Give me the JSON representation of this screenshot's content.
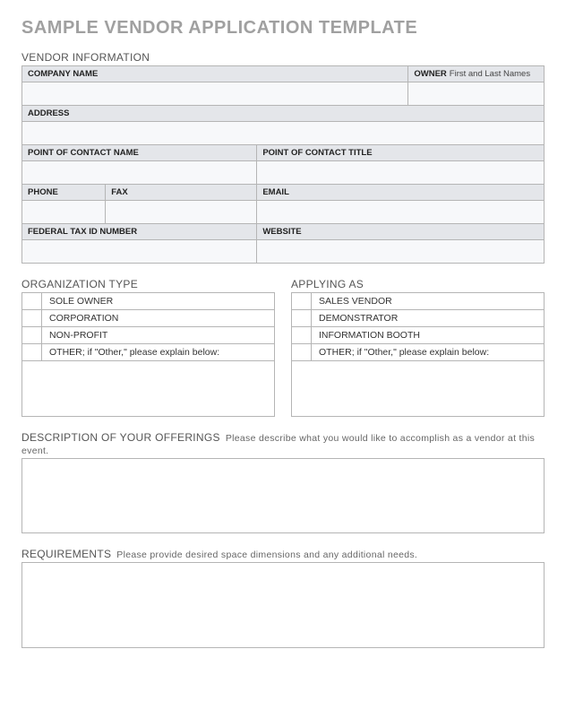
{
  "title": "SAMPLE VENDOR APPLICATION TEMPLATE",
  "vendor_info": {
    "section_label": "VENDOR INFORMATION",
    "company_label": "COMPANY NAME",
    "company_value": "",
    "owner_label": "OWNER",
    "owner_sub": "First and Last Names",
    "owner_value": "",
    "address_label": "ADDRESS",
    "address_value": "",
    "poc_name_label": "POINT OF CONTACT NAME",
    "poc_name_value": "",
    "poc_title_label": "POINT OF CONTACT TITLE",
    "poc_title_value": "",
    "phone_label": "PHONE",
    "phone_value": "",
    "fax_label": "FAX",
    "fax_value": "",
    "email_label": "EMAIL",
    "email_value": "",
    "tax_label": "FEDERAL TAX ID NUMBER",
    "tax_value": "",
    "website_label": "WEBSITE",
    "website_value": ""
  },
  "org_type": {
    "section_label": "ORGANIZATION TYPE",
    "options": [
      "SOLE OWNER",
      "CORPORATION",
      "NON-PROFIT",
      "OTHER; if \"Other,\" please explain below:"
    ],
    "explain_value": ""
  },
  "applying_as": {
    "section_label": "APPLYING AS",
    "options": [
      "SALES VENDOR",
      "DEMONSTRATOR",
      "INFORMATION BOOTH",
      "OTHER; if \"Other,\" please explain below:"
    ],
    "explain_value": ""
  },
  "description": {
    "section_label": "DESCRIPTION OF YOUR OFFERINGS",
    "hint": "Please describe what you would like to accomplish as a vendor at this event.",
    "value": ""
  },
  "requirements": {
    "section_label": "REQUIREMENTS",
    "hint": "Please provide desired space dimensions and any additional needs.",
    "value": ""
  }
}
